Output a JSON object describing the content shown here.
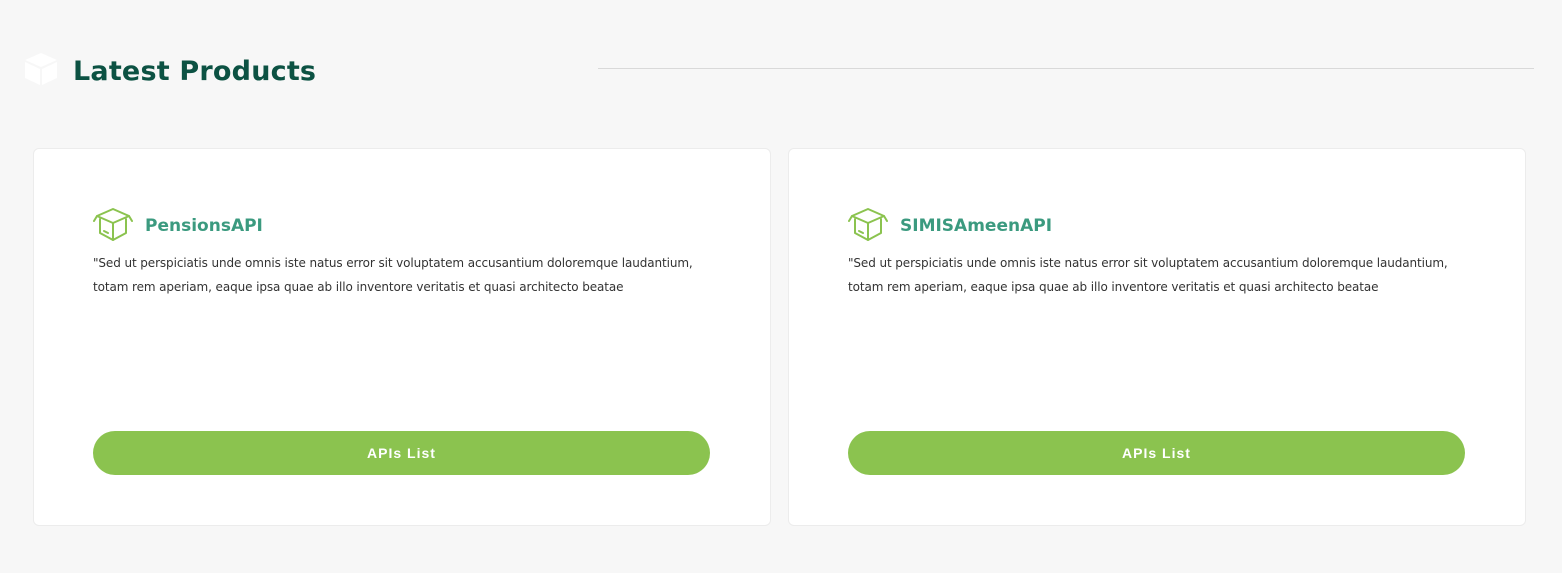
{
  "section": {
    "title": "Latest Products",
    "icon": "box-icon"
  },
  "colors": {
    "background": "#f7f7f7",
    "title": "#0c5243",
    "product_name": "#3b9a7f",
    "accent": "#8bc34f"
  },
  "products": [
    {
      "name": "PensionsAPI",
      "icon": "open-box-icon",
      "description": "\"Sed ut perspiciatis unde omnis iste natus error sit voluptatem accusantium doloremque laudantium, totam rem aperiam, eaque ipsa quae ab illo inventore veritatis et quasi architecto beatae",
      "button_label": "APIs List"
    },
    {
      "name": "SIMISAmeenAPI",
      "icon": "open-box-icon",
      "description": "\"Sed ut perspiciatis unde omnis iste natus error sit voluptatem accusantium doloremque laudantium, totam rem aperiam, eaque ipsa quae ab illo inventore veritatis et quasi architecto beatae",
      "button_label": "APIs List"
    }
  ]
}
